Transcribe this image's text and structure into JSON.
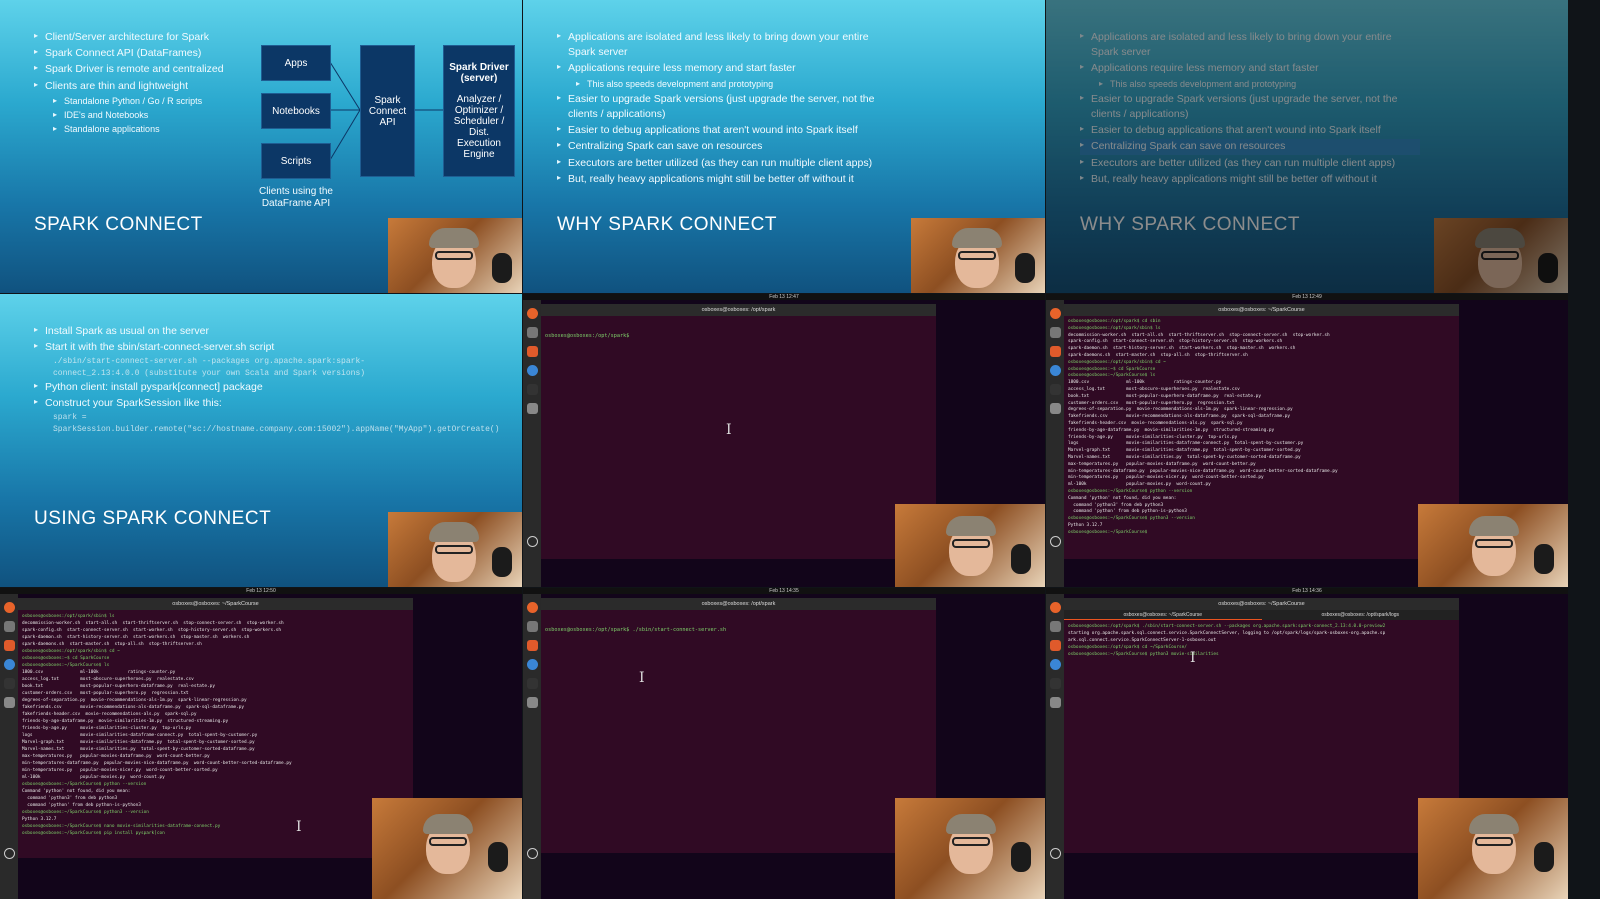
{
  "panels": {
    "p1": {
      "bullets": [
        "Client/Server architecture for Spark",
        "Spark Connect API (DataFrames)",
        "Spark Driver is remote and centralized",
        "Clients are thin and lightweight"
      ],
      "subbullets": [
        "Standalone Python / Go / R scripts",
        "IDE's and Notebooks",
        "Standalone applications"
      ],
      "diagram": {
        "apps": "Apps",
        "notebooks": "Notebooks",
        "scripts": "Scripts",
        "connect": "Spark Connect API",
        "driver_title": "Spark Driver (server)",
        "driver_body": "Analyzer / Optimizer / Scheduler / Dist. Execution Engine",
        "caption": "Clients using the DataFrame API"
      },
      "title": "SPARK CONNECT"
    },
    "p2": {
      "bullets": [
        "Applications are isolated and less likely to bring down your entire Spark server",
        "Applications require less memory and start faster",
        "Easier to upgrade Spark versions (just upgrade the server, not the clients / applications)",
        "Easier to debug applications that aren't wound into Spark itself",
        "Centralizing Spark can save on resources",
        "Executors are better utilized (as they can run multiple client apps)",
        "But, really heavy applications might still be better off without it"
      ],
      "sub": "This also speeds development and prototyping",
      "title": "WHY SPARK CONNECT"
    },
    "p3": {
      "title": "WHY SPARK CONNECT",
      "highlight": "Centralizing Spark can save on resources"
    },
    "p4": {
      "bullets": [
        "Install Spark as usual on the server",
        "Start it with the sbin/start-connect-server.sh script",
        "Python client: install pyspark[connect] package",
        "Construct your SparkSession like this:"
      ],
      "code1": "./sbin/start-connect-server.sh --packages org.apache.spark:spark-connect_2.13:4.0.0 (substitute your own Scala and Spark versions)",
      "code2": "spark = SparkSession.builder.remote(\"sc://hostname.company.com:15002\").appName(\"MyApp\").getOrCreate()",
      "title": "USING SPARK CONNECT"
    },
    "p5": {
      "clock": "Feb 13 12:47",
      "window_title": "osboxes@osboxes: /opt/spark",
      "lines": [
        "osboxes@osboxes:/opt/spark$ "
      ]
    },
    "p6": {
      "clock": "Feb 13 12:49",
      "window_title": "osboxes@osboxes: ~/SparkCourse",
      "lines": [
        "osboxes@osboxes:/opt/spark$ cd sbin",
        "osboxes@osboxes:/opt/spark/sbin$ ls",
        "decommission-worker.sh  start-all.sh  start-thriftserver.sh  stop-connect-server.sh  stop-worker.sh",
        "spark-config.sh  start-connect-server.sh  stop-history-server.sh  stop-workers.sh",
        "spark-daemon.sh  start-history-server.sh  start-workers.sh  stop-master.sh  workers.sh",
        "spark-daemons.sh  start-master.sh  stop-all.sh  stop-thriftserver.sh",
        "osboxes@osboxes:/opt/spark/sbin$ cd ~",
        "osboxes@osboxes:~$ cd SparkCourse",
        "osboxes@osboxes:~/SparkCourse$ ls",
        "1800.csv              ml-100k           ratings-counter.py",
        "access_log.txt        most-obscure-superheroes.py  realestate.csv",
        "book.txt              most-popular-superhero-dataframe.py  real-estate.py",
        "customer-orders.csv   most-popular-superhero.py  regression.txt",
        "degrees-of-separation.py  movie-recommendations-als-1m.py  spark-linear-regression.py",
        "fakefriends.csv       movie-recommendations-als-dataframe.py  spark-sql-dataframe.py",
        "fakefriends-header.csv  movie-recommendations-als.py  spark-sql.py",
        "friends-by-age-dataframe.py  movie-similarities-1m.py  structured-streaming.py",
        "friends-by-age.py     movie-similarities-cluster.py  top-urls.py",
        "logs                  movie-similarities-dataframe-connect.py  total-spent-by-customer.py",
        "Marvel-graph.txt      movie-similarities-dataframe.py  total-spent-by-customer-sorted.py",
        "Marvel-names.txt      movie-similarities.py  total-spent-by-customer-sorted-dataframe.py",
        "max-temperatures.py   popular-movies-dataframe.py  word-count-better.py",
        "min-temperatures-dataframe.py  popular-movies-nice-dataframe.py  word-count-better-sorted-dataframe.py",
        "min-temperatures.py   popular-movies-nicer.py  word-count-better-sorted.py",
        "ml-100k               popular-movies.py  word-count.py",
        "osboxes@osboxes:~/SparkCourse$ python --version",
        "Command 'python' not found, did you mean:",
        "  command 'python3' from deb python3",
        "  command 'python' from deb python-is-python3",
        "osboxes@osboxes:~/SparkCourse$ python3 --version",
        "Python 3.12.7",
        "osboxes@osboxes:~/SparkCourse$ "
      ]
    },
    "p7": {
      "clock": "Feb 13 12:50",
      "window_title": "osboxes@osboxes: ~/SparkCourse",
      "lines": [
        "osboxes@osboxes:/opt/spark/sbin$ ls",
        "decommission-worker.sh  start-all.sh  start-thriftserver.sh  stop-connect-server.sh  stop-worker.sh",
        "spark-config.sh  start-connect-server.sh  start-worker.sh  stop-history-server.sh  stop-workers.sh",
        "spark-daemon.sh  start-history-server.sh  start-workers.sh  stop-master.sh  workers.sh",
        "spark-daemons.sh  start-master.sh  stop-all.sh  stop-thriftserver.sh",
        "osboxes@osboxes:/opt/spark/sbin$ cd ~",
        "osboxes@osboxes:~$ cd SparkCourse",
        "osboxes@osboxes:~/SparkCourse$ ls",
        "1800.csv              ml-100k           ratings-counter.py",
        "access_log.txt        most-obscure-superheroes.py  realestate.csv",
        "book.txt              most-popular-superhero-dataframe.py  real-estate.py",
        "customer-orders.csv   most-popular-superhero.py  regression.txt",
        "degrees-of-separation.py  movie-recommendations-als-1m.py  spark-linear-regression.py",
        "fakefriends.csv       movie-recommendations-als-dataframe.py  spark-sql-dataframe.py",
        "fakefriends-header.csv  movie-recommendations-als.py  spark-sql.py",
        "friends-by-age-dataframe.py  movie-similarities-1m.py  structured-streaming.py",
        "friends-by-age.py     movie-similarities-cluster.py  top-urls.py",
        "logs                  movie-similarities-dataframe-connect.py  total-spent-by-customer.py",
        "Marvel-graph.txt      movie-similarities-dataframe.py  total-spent-by-customer-sorted.py",
        "Marvel-names.txt      movie-similarities.py  total-spent-by-customer-sorted-dataframe.py",
        "max-temperatures.py   popular-movies-dataframe.py  word-count-better.py",
        "min-temperatures-dataframe.py  popular-movies-nice-dataframe.py  word-count-better-sorted-dataframe.py",
        "min-temperatures.py   popular-movies-nicer.py  word-count-better-sorted.py",
        "ml-100k               popular-movies.py  word-count.py",
        "osboxes@osboxes:~/SparkCourse$ python --version",
        "Command 'python' not found, did you mean:",
        "  command 'python3' from deb python3",
        "  command 'python' from deb python-is-python3",
        "osboxes@osboxes:~/SparkCourse$ python3 --version",
        "Python 3.12.7",
        "osboxes@osboxes:~/SparkCourse$ nano movie-similarities-dataframe-connect.py",
        "osboxes@osboxes:~/SparkCourse$ pip install pyspark[con"
      ]
    },
    "p8": {
      "clock": "Feb 13 14:35",
      "window_title": "osboxes@osboxes: /opt/spark",
      "lines": [
        "osboxes@osboxes:/opt/spark$ ./sbin/start-connect-server.sh"
      ]
    },
    "p9": {
      "clock": "Feb 13 14:36",
      "window_title": "osboxes@osboxes: ~/SparkCourse",
      "tabs": [
        "osboxes@osboxes: ~/SparkCourse",
        "osboxes@osboxes: /opt/spark/logs"
      ],
      "lines": [
        "osboxes@osboxes:/opt/spark$ ./sbin/start-connect-server.sh --packages org.apache.spark:spark-connect_2.13:4.0.0-preview2",
        "starting org.apache.spark.sql.connect.service.SparkConnectServer, logging to /opt/spark/logs/spark-osboxes-org.apache.sp",
        "ark.sql.connect.service.SparkConnectServer-1-osboxes.out",
        "osboxes@osboxes:/opt/spark$ cd ~/SparkCourse/",
        "osboxes@osboxes:~/SparkCourse$ python3 movie-similarities"
      ]
    }
  },
  "colors": {
    "slide_top": "#5ed2ea",
    "slide_bottom": "#10527f",
    "terminal": "#300a24",
    "prompt": "#7fd36b",
    "highlight": "#2d90d0"
  }
}
